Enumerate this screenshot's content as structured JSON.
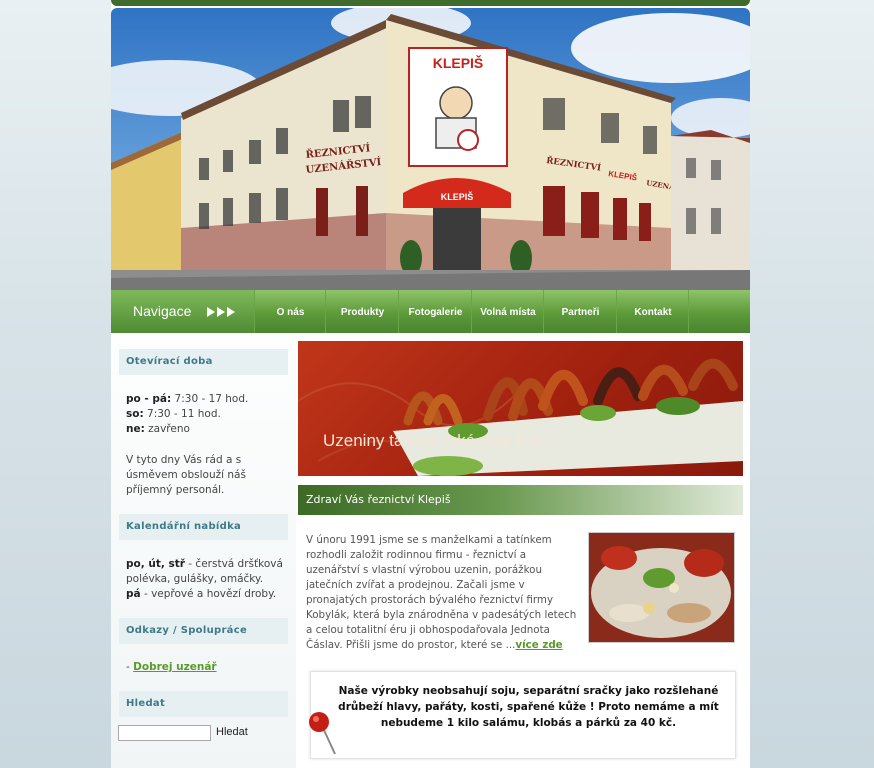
{
  "header": {
    "sign_main": "KLEPIŠ",
    "wall_text_left_1": "ŘEZNICTVÍ",
    "wall_text_left_2": "UZENÁŘSTVÍ",
    "wall_text_right_1": "ŘEZNICTVÍ",
    "wall_text_right_2": "KLEPIŠ",
    "wall_text_right_3": "UZENÁŘSTVÍ",
    "awning_text": "KLEPIŠ"
  },
  "nav": {
    "title": "Navigace",
    "arrows_icon": "triple-arrow-icon",
    "items": [
      {
        "label": "O nás"
      },
      {
        "label": "Produkty"
      },
      {
        "label": "Fotogalerie"
      },
      {
        "label": "Volná místa"
      },
      {
        "label": "Partneři"
      },
      {
        "label": "Kontakt"
      }
    ]
  },
  "sidebar": {
    "opening": {
      "heading": "Otevírací doba",
      "rows": [
        {
          "day": "po - pá:",
          "hours": " 7:30 - 17 hod."
        },
        {
          "day": "so:",
          "hours": " 7:30 - 11 hod."
        },
        {
          "day": "ne:",
          "hours": " zavřeno"
        }
      ],
      "note": "V tyto dny Vás rád a s úsměvem obslouží náš příjemný personál."
    },
    "calendar": {
      "heading": "Kalendářní nabídka",
      "line1_days": "po, út, stř",
      "line1_text": " - čerstvá dršťková polévka, gulášky, omáčky.",
      "line2_days": "pá",
      "line2_text": " - vepřové a hovězí droby."
    },
    "links": {
      "heading": "Odkazy / Spolupráce",
      "prefix": "- ",
      "link_label": "Dobrej uzenář"
    },
    "search": {
      "heading": "Hledat",
      "input_value": "",
      "button_label": "Hledat"
    }
  },
  "main": {
    "banner_text": "Uzeniny takové jaké mají být !",
    "welcome_title": "Zdraví Vás řeznictví Klepiš",
    "article_text": "V únoru 1991 jsme se s manželkami a tatínkem rozhodli založit rodinnou firmu - řeznictví a uzenářství s vlastní výrobou uzenin, porážkou jatečních zvířat a prodejnou. Začali jsme v pronajatých prostorách bývalého řeznictví firmy Kobylák, která byla znárodněna v padesátých letech a celou totalitní éru ji obhospodařovala Jednota Čáslav. Přišli jsme do prostor, které se ...",
    "more_link": "více zde",
    "notice_text": "Naše výrobky neobsahují soju, separátní sračky jako rozšlehané drůbeží hlavy, pařáty, kosti, spařené kůže ! Proto nemáme a mít nebudeme 1 kilo salámu, klobás a párků za 40 kč."
  },
  "colors": {
    "nav_green": "#5c9a3a",
    "banner_red": "#a2210f",
    "heading_teal": "#3f7a86",
    "link_green": "#5a9a2a"
  }
}
